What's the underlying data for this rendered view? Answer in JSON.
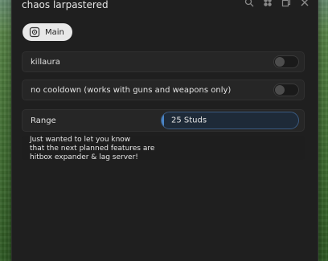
{
  "window": {
    "title": "chaos larpastered"
  },
  "controls": [
    "search-icon",
    "palette-icon",
    "restore-icon",
    "close-icon"
  ],
  "tabs": [
    {
      "label": "Main",
      "icon": "gear-icon",
      "active": true
    }
  ],
  "toggles": [
    {
      "label": "killaura",
      "on": false
    },
    {
      "label": "no cooldown (works with guns and weapons only)",
      "on": false
    }
  ],
  "slider": {
    "label": "Range",
    "value_text": "25 Studs",
    "level": 0.01,
    "accent": "#4a86c9"
  },
  "note": {
    "text": "Just wanted to let you know\nthat the next planned features are\nhitbox expander & lag server!"
  }
}
